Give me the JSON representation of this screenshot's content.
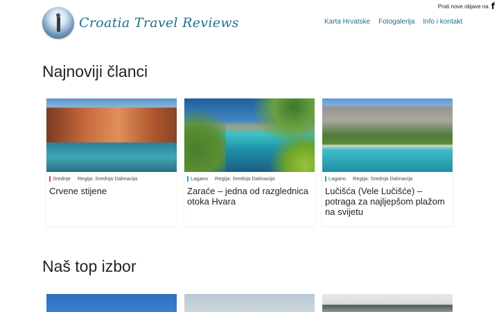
{
  "topbar": {
    "follow_text": "Prati nove objave na",
    "icon": "facebook-icon"
  },
  "logo": {
    "title": "Croatia Travel Reviews"
  },
  "nav": [
    {
      "label": "Karta Hrvatske"
    },
    {
      "label": "Fotogalerija"
    },
    {
      "label": "Info i kontakt"
    }
  ],
  "latest": {
    "title": "Najnoviji članci",
    "cards": [
      {
        "difficulty": "Srednje",
        "difficulty_color": "#d63aa5",
        "region": "Regija: Srednja Dalmacija",
        "title": "Crvene stijene"
      },
      {
        "difficulty": "Lagano",
        "difficulty_color": "#2a9fd6",
        "region": "Regija: Srednja Dalmacija",
        "title": "Zaraće – jedna od razglednica otoka Hvara"
      },
      {
        "difficulty": "Lagano",
        "difficulty_color": "#2a9fd6",
        "region": "Regija: Srednja Dalmacija",
        "title": "Lučišća (Vele Lučišće) – potraga za najljepšom plažom na svijetu"
      }
    ]
  },
  "top_pick": {
    "title": "Naš top izbor"
  }
}
